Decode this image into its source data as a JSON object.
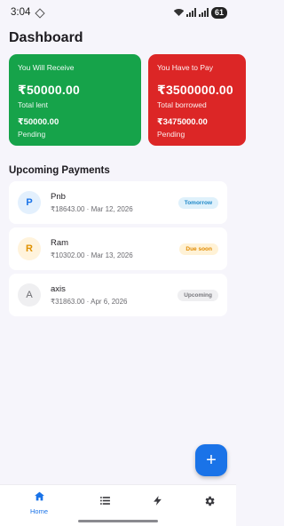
{
  "status_bar": {
    "time": "3:04",
    "battery": "61"
  },
  "header": {
    "title": "Dashboard"
  },
  "cards": {
    "receive": {
      "heading": "You Will Receive",
      "amount": "₹50000.00",
      "amount_label": "Total lent",
      "pending_amount": "₹50000.00",
      "pending_label": "Pending",
      "color": "#16a34a"
    },
    "pay": {
      "heading": "You Have to Pay",
      "amount": "₹3500000.00",
      "amount_label": "Total borrowed",
      "pending_amount": "₹3475000.00",
      "pending_label": "Pending",
      "color": "#dc2626"
    }
  },
  "upcoming": {
    "title": "Upcoming Payments",
    "items": [
      {
        "initial": "P",
        "name": "Pnb",
        "meta": "₹18643.00 · Mar 12, 2026",
        "badge": "Tomorrow",
        "avatar_bg": "#e3f0fd",
        "avatar_fg": "#1a73e8",
        "badge_bg": "#dff1fb",
        "badge_fg": "#1e88c8"
      },
      {
        "initial": "R",
        "name": "Ram",
        "meta": "₹10302.00 · Mar 13, 2026",
        "badge": "Due soon",
        "avatar_bg": "#fff3dc",
        "avatar_fg": "#e09100",
        "badge_bg": "#fff2d6",
        "badge_fg": "#e08a00"
      },
      {
        "initial": "A",
        "name": "axis",
        "meta": "₹31863.00 · Apr 6, 2026",
        "badge": "Upcoming",
        "avatar_bg": "#efeff1",
        "avatar_fg": "#6d6d72",
        "badge_bg": "#efeff1",
        "badge_fg": "#77777c"
      }
    ]
  },
  "fab": {
    "label": "+"
  },
  "bottom_nav": {
    "items": [
      {
        "label": "Home",
        "icon": "home-icon",
        "active": true
      },
      {
        "label": "",
        "icon": "list-icon",
        "active": false
      },
      {
        "label": "",
        "icon": "bolt-icon",
        "active": false
      },
      {
        "label": "",
        "icon": "gear-icon",
        "active": false
      }
    ]
  },
  "colors": {
    "accent": "#1a73e8",
    "background": "#f6f5fb"
  }
}
